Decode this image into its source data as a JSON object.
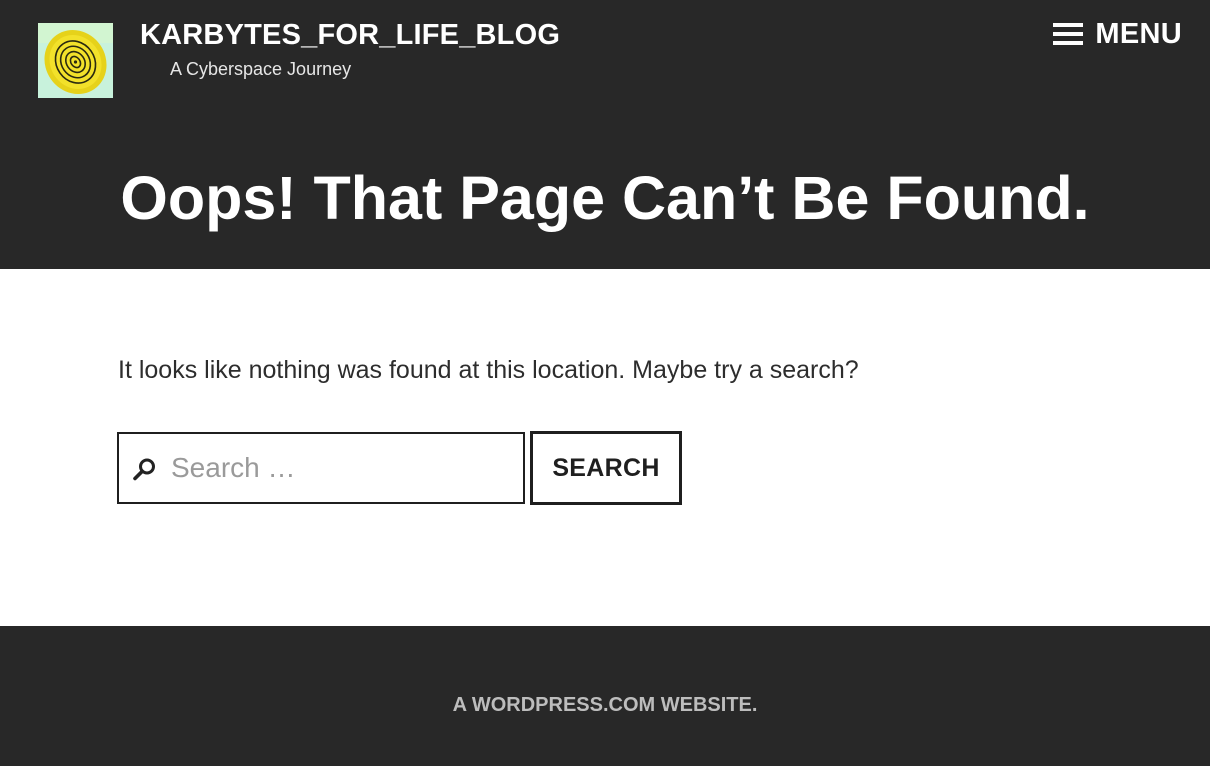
{
  "header": {
    "site_title": "KARBYTES_FOR_LIFE_BLOG",
    "tagline": "A Cyberspace Journey",
    "menu_label": "MENU",
    "logo_icon": "spiral-logo-icon",
    "menu_icon": "hamburger-menu-icon"
  },
  "main": {
    "page_title": "Oops! That Page Can’t Be Found.",
    "message": "It looks like nothing was found at this location. Maybe try a search?",
    "search": {
      "placeholder": "Search …",
      "value": "",
      "button_label": "SEARCH",
      "icon": "search-icon"
    }
  },
  "footer": {
    "credit": "A WORDPRESS.COM WEBSITE."
  },
  "colors": {
    "header_bg": "#282828",
    "footer_bg": "#282828",
    "body_bg": "#ffffff",
    "text_dark": "#2d2d2d",
    "footer_text": "#bdbdbd"
  }
}
